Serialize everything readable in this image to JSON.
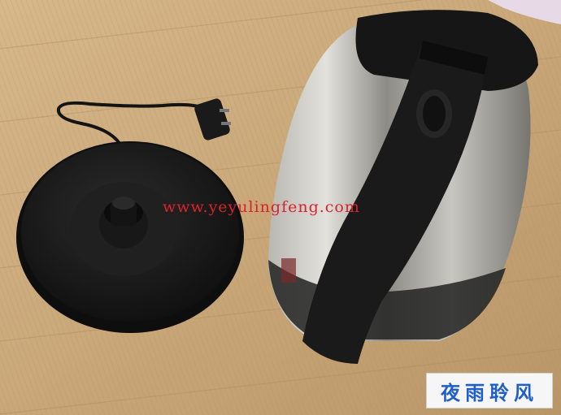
{
  "photo": {
    "watermark_text": "www.yeyulingfeng.com",
    "logo_text": "夜雨聆风",
    "colors": {
      "floor_mat": "#c9a779",
      "plastic_black": "#1c1c1c",
      "steel": "#9a9894",
      "watermark": "#d8232a",
      "logo_blue": "#1e5fc9"
    }
  }
}
